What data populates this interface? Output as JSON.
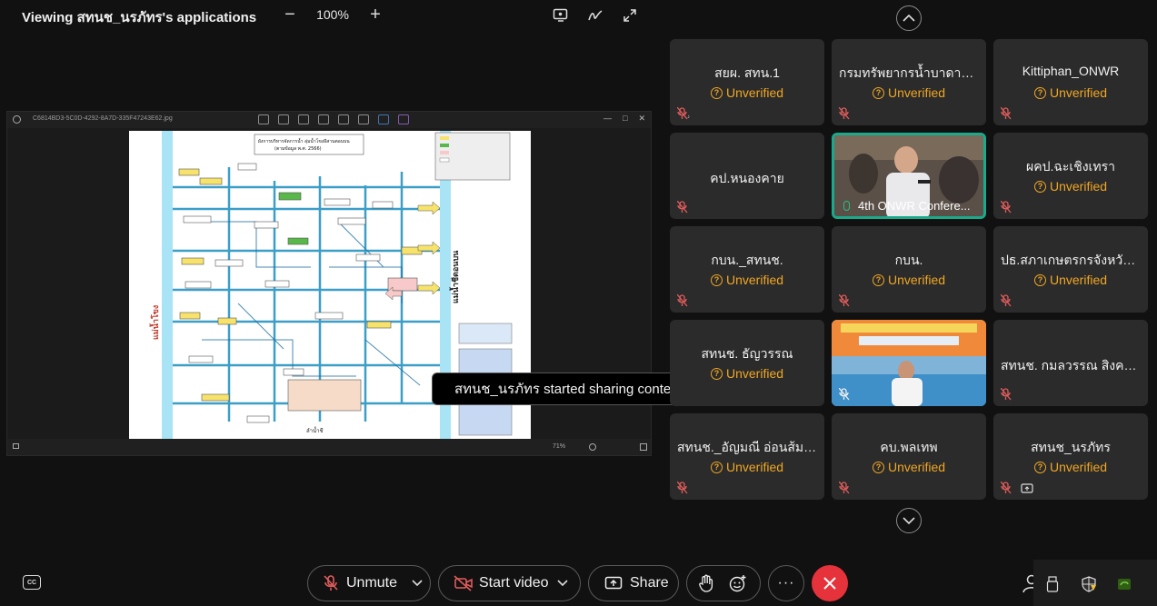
{
  "header": {
    "viewing_title": "Viewing สทนช_นรภัทร's applications",
    "zoom_level": "100%",
    "zoom_out_symbol": "−",
    "zoom_in_symbol": "+",
    "icons": [
      "annotation-icon",
      "pen-icon",
      "fullscreen-icon"
    ]
  },
  "shared_window": {
    "filename": "C6814BD3-5C0D-4292-8A7D-335F47243E62.jpg",
    "zoom_text": "71%",
    "win_buttons": [
      "—",
      "□",
      "✕"
    ],
    "document": {
      "title_line1": "ผังการบริหารจัดการน้ำ ลุ่มน้ำโขงอีสานตอนบน",
      "title_line2": "(ตามข้อมูล พ.ศ. 2566)",
      "left_label": "แม่น้ำโขง",
      "right_label": "แม่น้ำชีตอนบน",
      "bottom_label": "ลำน้ำชี"
    }
  },
  "toast": {
    "message": "สทนช_นรภัทร started sharing content..."
  },
  "participants": [
    {
      "name": "สยผ. สทน.1",
      "status": "Unverified",
      "type": "name"
    },
    {
      "name": "กรมทรัพยากรน้ำบาดาล ...",
      "status": "Unverified",
      "type": "name"
    },
    {
      "name": "Kittiphan_ONWR",
      "status": "Unverified",
      "type": "name"
    },
    {
      "name": "คป.หนองคาย",
      "status": "",
      "type": "name"
    },
    {
      "name": "4th ONWR Confere...",
      "status": "",
      "type": "video-active"
    },
    {
      "name": "ผคป.ฉะเชิงเทรา",
      "status": "Unverified",
      "type": "name"
    },
    {
      "name": "กบน._สทนช.",
      "status": "Unverified",
      "type": "name"
    },
    {
      "name": "กบน.",
      "status": "Unverified",
      "type": "name"
    },
    {
      "name": "ปธ.สภาเกษตรกรจังหวัด...",
      "status": "Unverified",
      "type": "name"
    },
    {
      "name": "สทนช. ธัญวรรณ",
      "status": "Unverified",
      "type": "name"
    },
    {
      "name": "",
      "status": "",
      "type": "video"
    },
    {
      "name": "สทนช. กมลวรรณ สิงคะเ...",
      "status": "",
      "type": "name"
    },
    {
      "name": "สทนช._อัญมณี อ่อนส้มก...",
      "status": "Unverified",
      "type": "name"
    },
    {
      "name": "คบ.พลเทพ",
      "status": "Unverified",
      "type": "name"
    },
    {
      "name": "สทนช_นรภัทร",
      "status": "Unverified",
      "type": "name"
    }
  ],
  "controls": {
    "unmute_label": "Unmute",
    "start_video_label": "Start video",
    "share_label": "Share",
    "more_symbol": "···",
    "cc_label": "CC"
  },
  "colors": {
    "accent_unverified": "#f0a623",
    "end_call": "#e5323b",
    "active_speaker": "#1aa98a"
  }
}
